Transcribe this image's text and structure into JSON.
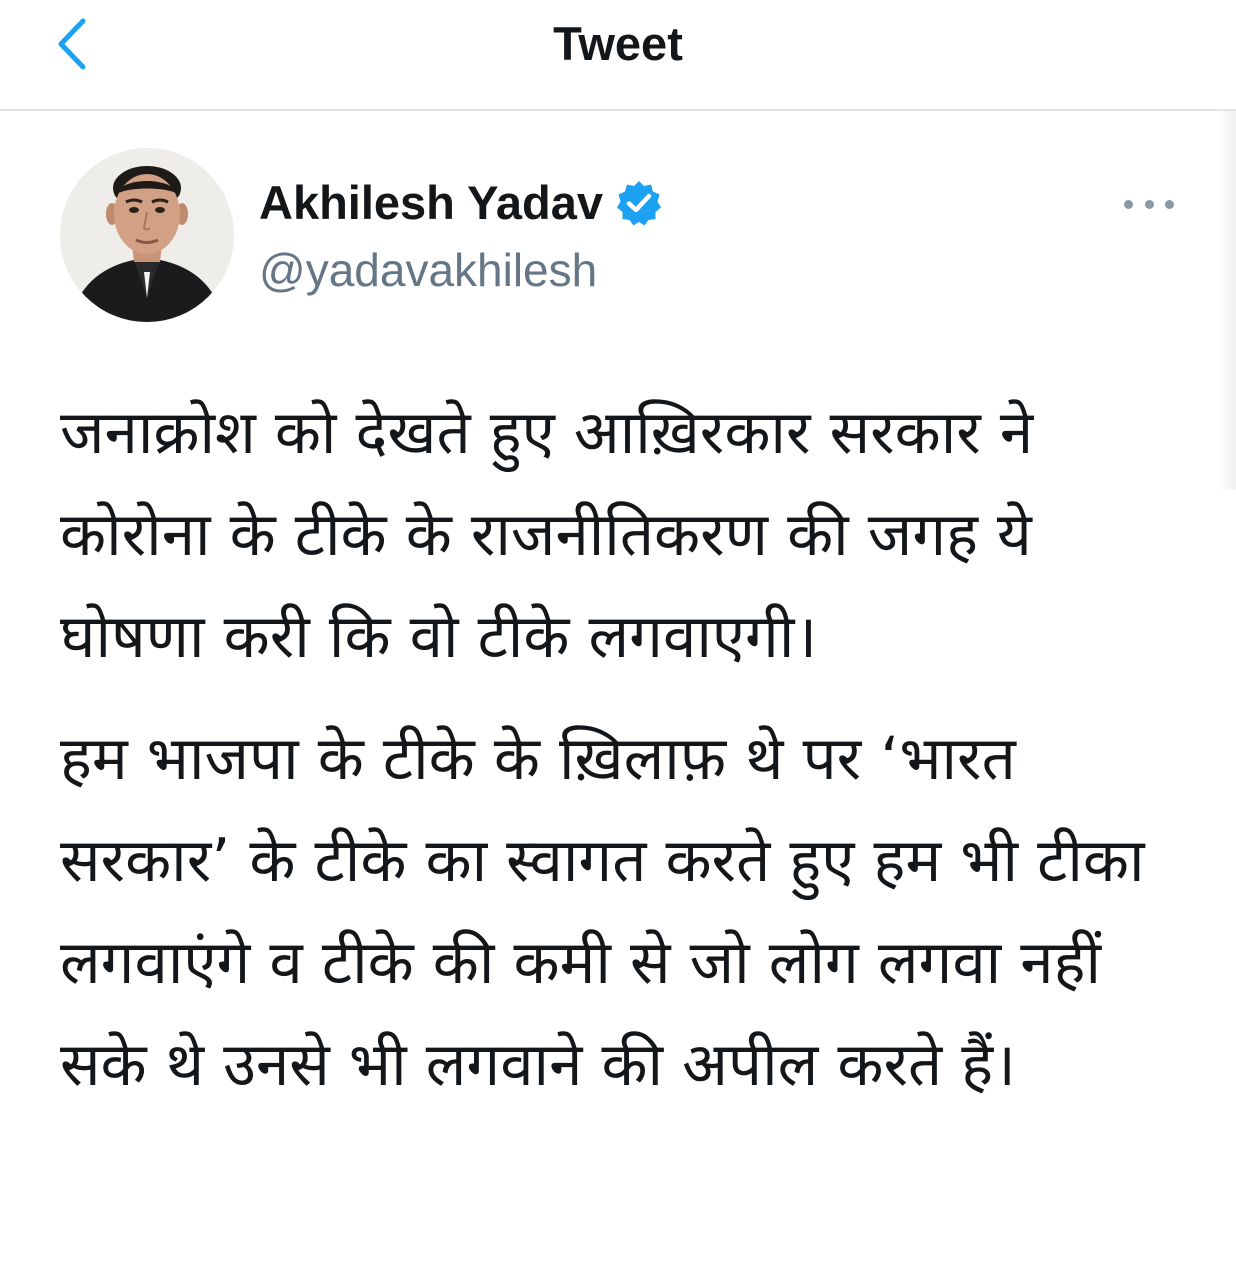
{
  "nav": {
    "back_icon": "chevron-left-icon",
    "title": "Tweet"
  },
  "author": {
    "display_name": "Akhilesh Yadav",
    "handle": "@yadavakhilesh",
    "verified": true,
    "verified_icon": "verified-badge-icon",
    "avatar": "profile photo"
  },
  "actions": {
    "more_icon": "more-horizontal-icon"
  },
  "tweet": {
    "paragraphs": [
      "जनाक्रोश को देखते हुए आख़िरकार सरकार ने कोरोना के टीके के राजनीतिकरण की जगह ये घोषणा करी कि वो टीके लगवाएगी।",
      "हम भाजपा के टीके के ख़िलाफ़ थे पर ‘भारत सरकार’ के टीके का स्वागत करते हुए हम भी टीका लगवाएंगे व टीके की कमी से जो लोग लगवा नहीं सके थे उनसे भी लगवाने की अपील करते हैं।"
    ]
  },
  "colors": {
    "accent": "#1da1f2",
    "text": "#14171a",
    "secondary": "#657786",
    "divider": "#e1e4e8"
  }
}
